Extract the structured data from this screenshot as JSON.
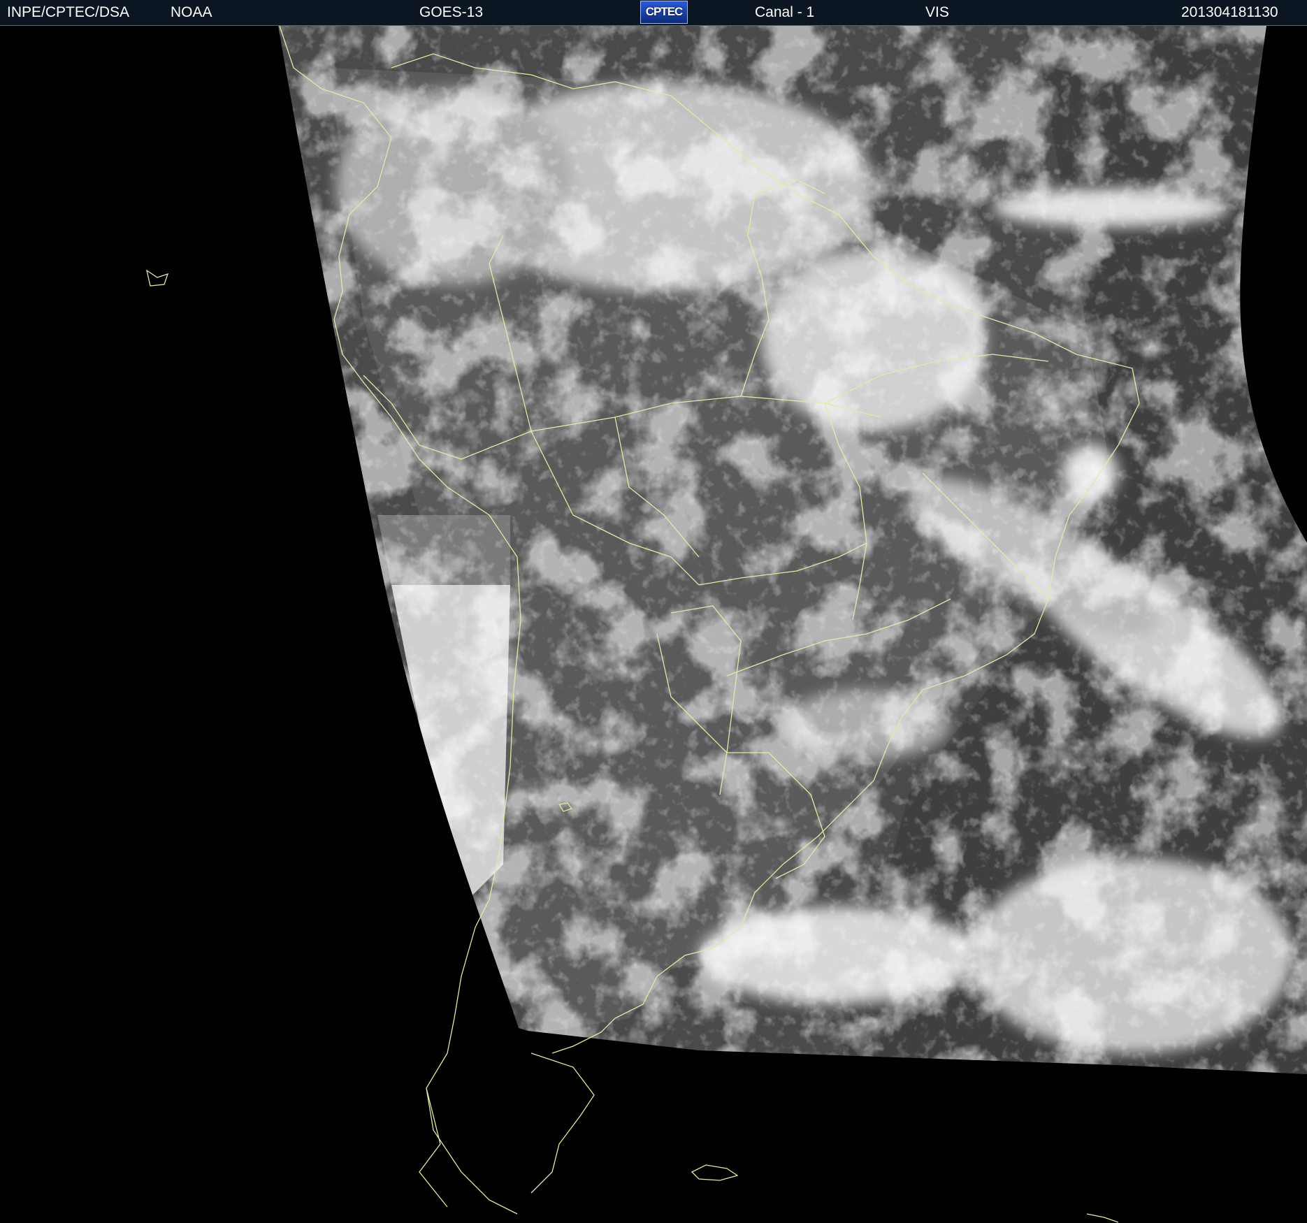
{
  "header": {
    "institution": "INPE/CPTEC/DSA",
    "agency": "NOAA",
    "satellite": "GOES-13",
    "logo_text": "CPTEC",
    "channel": "Canal - 1",
    "band": "VIS",
    "timestamp": "201304181130"
  },
  "colors": {
    "header_bg": "#0b1622",
    "background": "#000000",
    "coastline": "#e8e6a8",
    "cloud": "#ffffff",
    "land": "#585858"
  },
  "icons": {
    "logo": "cptec-logo"
  }
}
